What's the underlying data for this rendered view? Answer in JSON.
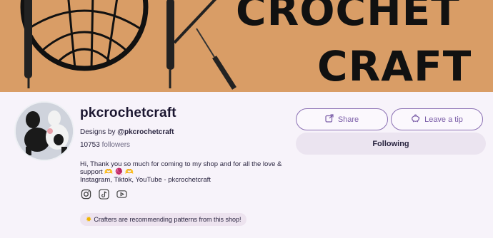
{
  "banner": {
    "line1": "CROCHET",
    "line2": "CRAFT"
  },
  "profile": {
    "shop_name": "pkcrochetcraft",
    "designs_prefix": "Designs by",
    "designs_handle": "@pkcrochetcraft",
    "followers_count": "10753",
    "followers_label": "followers",
    "bio_line1": "Hi, Thank you so much for coming to my shop and for all the love & support 🫶 🧶 🫶",
    "bio_line2": "Instagram, Tiktok, YouTube - pkcrochetcraft",
    "recommend_badge": "Crafters are recommending patterns from this shop!"
  },
  "socials": [
    {
      "icon": "instagram-icon"
    },
    {
      "icon": "tiktok-icon"
    },
    {
      "icon": "youtube-icon"
    }
  ],
  "actions": {
    "share_label": "Share",
    "tip_label": "Leave a tip",
    "follow_label": "Following"
  },
  "colors": {
    "banner_bg": "#d99d66",
    "accent": "#7b5ea8",
    "page_bg": "#f7f3fa"
  }
}
